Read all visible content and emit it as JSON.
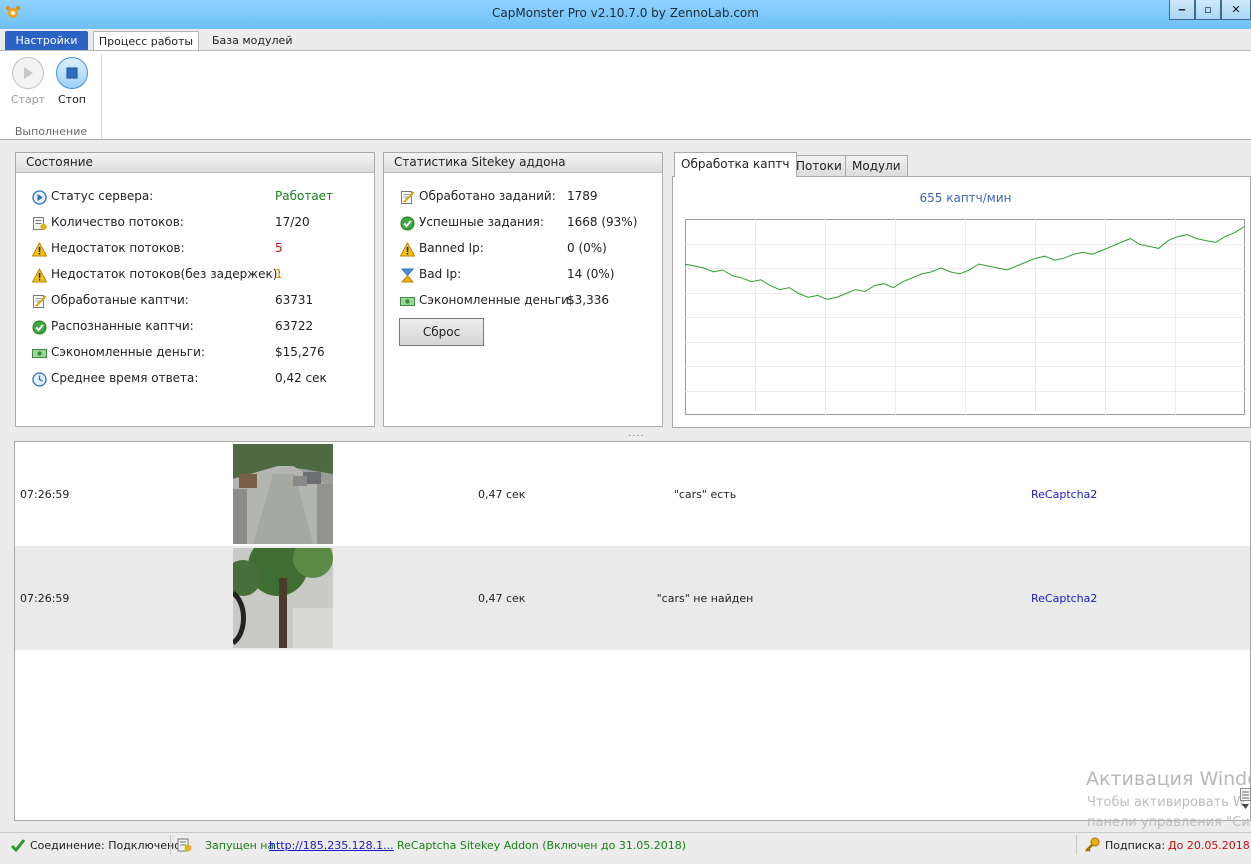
{
  "window": {
    "title": "CapMonster Pro v2.10.7.0 by ZennoLab.com",
    "controls": [
      "‒",
      "▫",
      "✕"
    ]
  },
  "ribbon": {
    "tabs": [
      "Настройки",
      "Процесс работы",
      "База модулей"
    ],
    "active_tab": "Процесс работы",
    "buttons": {
      "start": "Старт",
      "stop": "Стоп"
    },
    "group_label": "Выполнение"
  },
  "status_panel": {
    "title": "Состояние",
    "rows": [
      {
        "label": "Статус сервера:",
        "value": "Работает",
        "icon": "play-circle-icon",
        "color": "#1a7f1a"
      },
      {
        "label": "Количество потоков:",
        "value": "17/20",
        "icon": "threads-icon"
      },
      {
        "label": "Недостаток потоков:",
        "value": "5",
        "icon": "warning-icon",
        "color": "#c21010"
      },
      {
        "label": "Недостаток потоков(без задержек):",
        "value": "1",
        "icon": "warning-icon",
        "color": "#d78a00"
      },
      {
        "label": "Обработаные каптчи:",
        "value": "63731",
        "icon": "edit-doc-icon"
      },
      {
        "label": "Распознанные каптчи:",
        "value": "63722",
        "icon": "check-circle-icon"
      },
      {
        "label": "Сэкономленные деньги:",
        "value": "$15,276",
        "icon": "money-icon"
      },
      {
        "label": "Среднее время ответа:",
        "value": "0,42 сек",
        "icon": "clock-icon"
      }
    ]
  },
  "sitekey_panel": {
    "title": "Статистика Sitekey аддона",
    "rows": [
      {
        "label": "Обработано заданий:",
        "value": "1789",
        "icon": "edit-doc-icon"
      },
      {
        "label": "Успешные задания:",
        "value": "1668 (93%)",
        "icon": "check-circle-icon"
      },
      {
        "label": "Banned Ip:",
        "value": "0 (0%)",
        "icon": "warning-icon"
      },
      {
        "label": "Bad Ip:",
        "value": "14 (0%)",
        "icon": "hourglass-icon"
      },
      {
        "label": "Сэкономленные деньги:",
        "value": "$3,336",
        "icon": "money-icon"
      }
    ],
    "reset_label": "Сброс"
  },
  "chart_tabs": [
    "Обработка каптч",
    "Потоки",
    "Модули"
  ],
  "chart_data": {
    "type": "line",
    "title": "655 каптч/мин",
    "xlabel": "",
    "ylabel": "",
    "grid": true,
    "ylim": [
      0,
      100
    ],
    "series": [
      {
        "color": "#2e9e2e",
        "values": [
          77,
          76,
          75,
          73,
          74,
          71,
          70,
          68,
          69,
          66,
          64,
          65,
          62,
          60,
          61,
          59,
          60,
          62,
          64,
          63,
          66,
          67,
          65,
          68,
          70,
          72,
          73,
          75,
          73,
          72,
          74,
          77,
          76,
          75,
          74,
          76,
          78,
          80,
          81,
          79,
          80,
          82,
          83,
          82,
          84,
          86,
          88,
          90,
          87,
          86,
          85,
          89,
          91,
          92,
          90,
          89,
          88,
          91,
          93,
          96
        ]
      }
    ]
  },
  "log": {
    "rows": [
      {
        "time": "07:26:59",
        "duration": "0,47 сек",
        "result": "\"cars\" есть",
        "type": "ReCaptcha2"
      },
      {
        "time": "07:26:59",
        "duration": "0,47 сек",
        "result": "\"cars\" не найден",
        "type": "ReCaptcha2"
      }
    ]
  },
  "statusbar": {
    "connection": "Соединение: Подключено",
    "started_on": "Запущен на",
    "address": "http://185.235.128.1...",
    "addon": "ReCaptcha Sitekey Addon (Включен до 31.05.2018)",
    "subscription_label": "Подписка:",
    "subscription_until": "До 20.05.2018"
  },
  "watermark": {
    "line1": "Активация Windows",
    "line2": "Чтобы активировать W",
    "line3": "панели управления \"Си"
  }
}
